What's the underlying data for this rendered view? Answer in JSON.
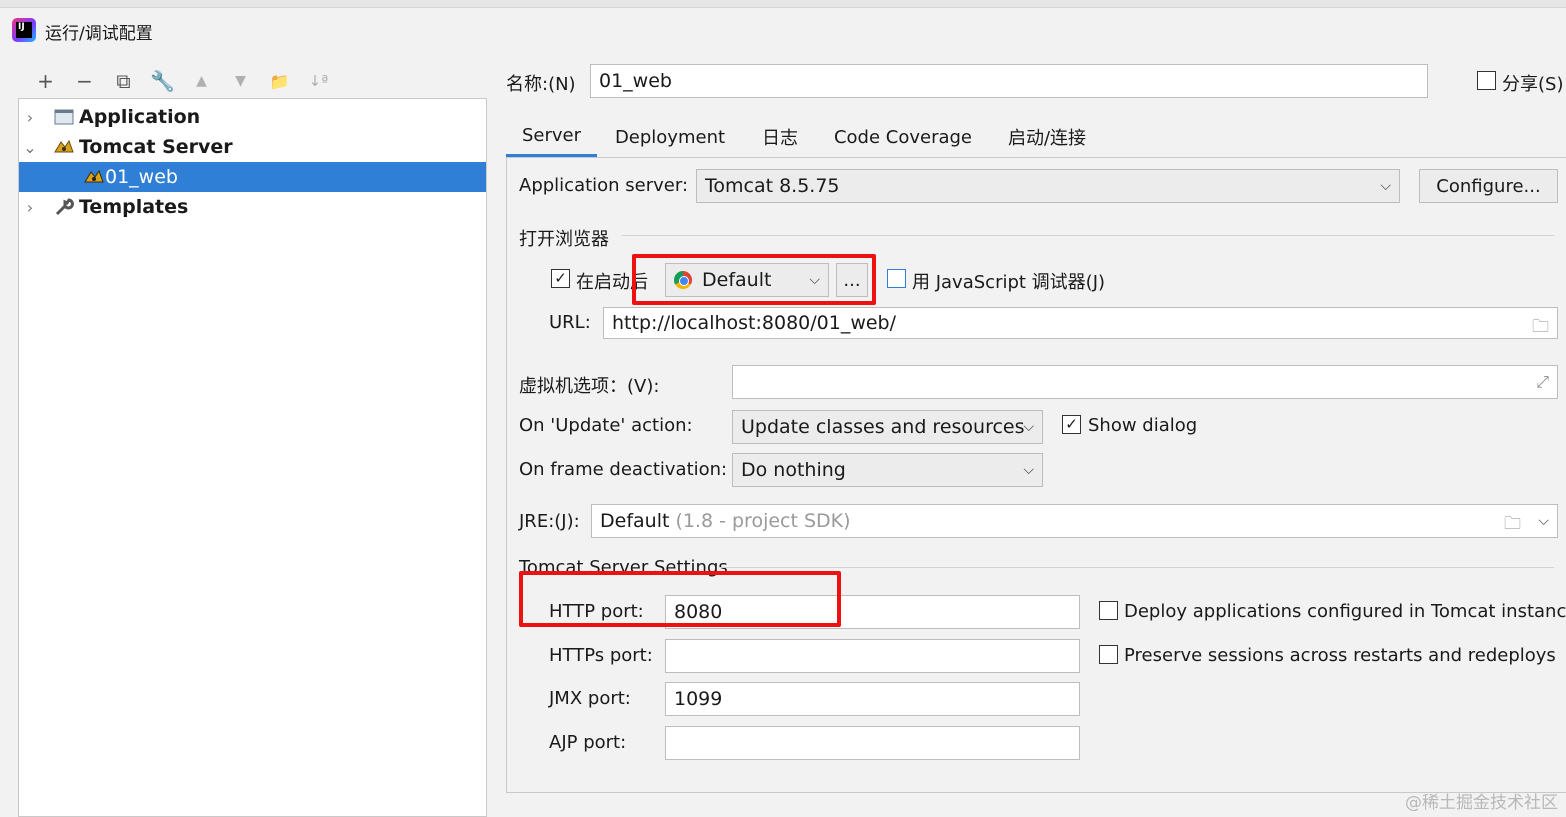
{
  "window": {
    "title": "运行/调试配置"
  },
  "toolbar": {
    "add": "+",
    "remove": "−",
    "copy": "⧉",
    "edit": "🔧",
    "up": "▲",
    "down": "▼",
    "folder": "📁",
    "sort": "↓ª"
  },
  "tree": {
    "items": [
      {
        "label": "Application",
        "icon": "application-icon",
        "chevron": "›"
      },
      {
        "label": "Tomcat Server",
        "icon": "tomcat-icon",
        "chevron": "⌄"
      },
      {
        "label": "01_web",
        "icon": "tomcat-icon",
        "selected": true
      },
      {
        "label": "Templates",
        "icon": "wrench-icon",
        "chevron": "›"
      }
    ]
  },
  "header": {
    "name_label": "名称:(N)",
    "name_value": "01_web",
    "share_label": "分享(S)"
  },
  "tabs": [
    "Server",
    "Deployment",
    "日志",
    "Code Coverage",
    "启动/连接"
  ],
  "server": {
    "app_server_label": "Application server:",
    "app_server_value": "Tomcat 8.5.75",
    "configure_label": "Configure...",
    "browser_section": "打开浏览器",
    "after_launch_label": "在启动后",
    "browser_value": "Default",
    "browser_more": "...",
    "js_debugger_label": "用 JavaScript 调试器(J)",
    "url_label": "URL:",
    "url_value": "http://localhost:8080/01_web/",
    "vm_label": "虚拟机选项：(V):",
    "vm_value": "",
    "update_label": "On 'Update' action:",
    "update_value": "Update classes and resources",
    "show_dialog_label": "Show dialog",
    "frame_label": "On frame deactivation:",
    "frame_value": "Do nothing",
    "jre_label": "JRE:(J):",
    "jre_value": "Default",
    "jre_hint": "(1.8 - project SDK)",
    "tomcat_section": "Tomcat Server Settings",
    "http_label": "HTTP port:",
    "http_value": "8080",
    "https_label": "HTTPs port:",
    "https_value": "",
    "jmx_label": "JMX port:",
    "jmx_value": "1099",
    "ajp_label": "AJP port:",
    "ajp_value": "",
    "deploy_label": "Deploy applications configured in Tomcat instance",
    "preserve_label": "Preserve sessions across restarts and redeploys"
  },
  "watermark": "@稀土掘金技术社区",
  "colors": {
    "accent": "#2f7fd6",
    "highlight": "#ee1111"
  }
}
